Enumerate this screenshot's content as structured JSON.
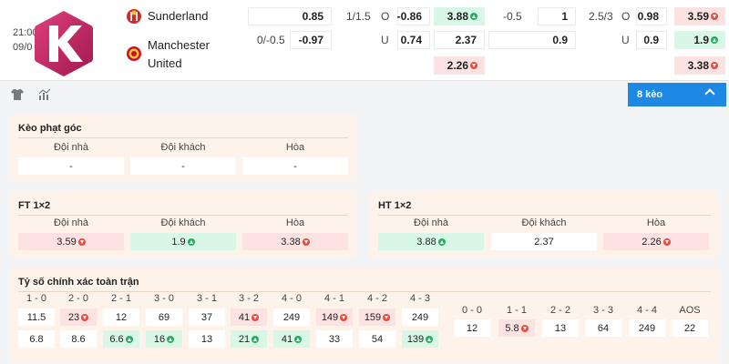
{
  "match": {
    "time": "21:00",
    "date": "09/0",
    "home_team": "Sunderland",
    "away_team_line1": "Manchester",
    "away_team_line2": "United",
    "row1": {
      "c1": "0.85",
      "hcap": "1/1.5",
      "o": "O",
      "c2": "-0.86",
      "c3": "3.88",
      "c4": "-0.5",
      "c5": "1",
      "hcap2": "2.5/3",
      "o2": "O",
      "c6": "0.98",
      "c7": "3.59"
    },
    "row2": {
      "hcap": "0/-0.5",
      "c1": "-0.97",
      "u": "U",
      "c2": "0.74",
      "c3": "2.37",
      "c5": "0.9",
      "u2": "U",
      "c6": "0.9",
      "c7": "1.9"
    },
    "row3": {
      "c3": "2.26",
      "c7": "3.38"
    }
  },
  "toolbar": {
    "keo_label": "8 kèo"
  },
  "corner": {
    "title": "Kèo phạt góc",
    "headers": [
      "Đội nhà",
      "Đội khách",
      "Hòa"
    ],
    "values": [
      "-",
      "-",
      "-"
    ]
  },
  "ft": {
    "title": "FT 1×2",
    "headers": [
      "Đội nhà",
      "Đội khách",
      "Hòa"
    ],
    "values": [
      "3.59",
      "1.9",
      "3.38"
    ]
  },
  "ht": {
    "title": "HT 1×2",
    "headers": [
      "Đội nhà",
      "Đội khách",
      "Hòa"
    ],
    "values": [
      "3.88",
      "2.37",
      "2.26"
    ]
  },
  "score": {
    "title": "Tỷ số chính xác toàn trận",
    "left_headers": [
      "1 - 0",
      "2 - 0",
      "2 - 1",
      "3 - 0",
      "3 - 1",
      "3 - 2",
      "4 - 0",
      "4 - 1",
      "4 - 2",
      "4 - 3"
    ],
    "left_row1": [
      "11.5",
      "23",
      "12",
      "69",
      "37",
      "41",
      "249",
      "149",
      "159",
      "249"
    ],
    "left_row2": [
      "6.8",
      "8.6",
      "6.6",
      "16",
      "13",
      "21",
      "41",
      "33",
      "54",
      "139"
    ],
    "right_headers": [
      "0 - 0",
      "1 - 1",
      "2 - 2",
      "3 - 3",
      "4 - 4",
      "AOS"
    ],
    "right_row": [
      "12",
      "5.8",
      "13",
      "64",
      "249",
      "22"
    ]
  }
}
